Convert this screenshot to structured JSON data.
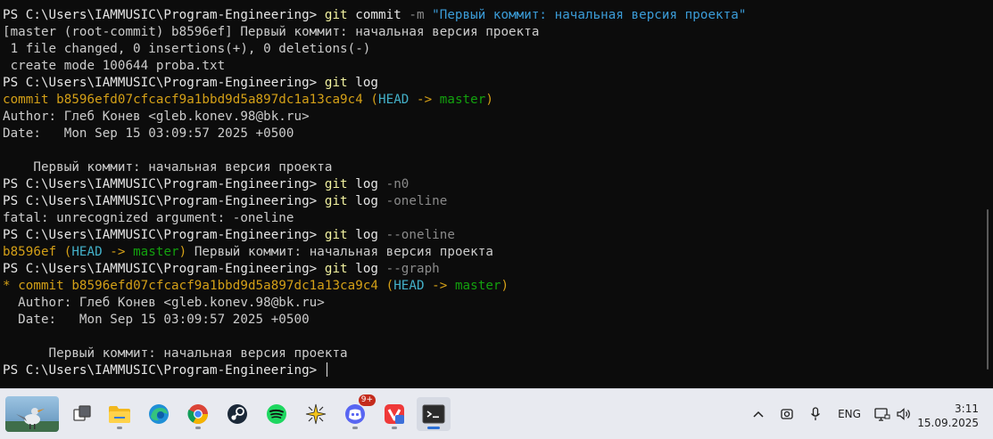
{
  "terminal": {
    "prompt": "PS C:\\Users\\IAMMUSIC\\Program-Engineering> ",
    "line01": {
      "cmd": "git",
      "args": " commit ",
      "flag": "-m",
      "msg": " \"Первый коммит: начальная версия проекта\""
    },
    "line02": "[master (root-commit) b8596ef] Первый коммит: начальная версия проекта",
    "line03": " 1 file changed, 0 insertions(+), 0 deletions(-)",
    "line04": " create mode 100644 proba.txt",
    "line05": {
      "cmd": "git",
      "args": " log"
    },
    "line06": {
      "commit_label": "commit ",
      "hash": "b8596efd07cfcacf9a1bbd9d5a897dc1a13ca9c4",
      "open": " (",
      "head": "HEAD",
      "arrow": " -> ",
      "branch": "master",
      "close": ")"
    },
    "line07": "Author: Глеб Конев <gleb.konev.98@bk.ru>",
    "line08": "Date:   Mon Sep 15 03:09:57 2025 +0500",
    "line09": "",
    "line10": "    Первый коммит: начальная версия проекта",
    "line11": {
      "cmd": "git",
      "args": " log ",
      "flag": "-n0"
    },
    "line12": {
      "cmd": "git",
      "args": " log ",
      "flag": "-oneline"
    },
    "line13": "fatal: unrecognized argument: -oneline",
    "line14": {
      "cmd": "git",
      "args": " log ",
      "flag": "--oneline"
    },
    "line15": {
      "hash": "b8596ef",
      "open": " (",
      "head": "HEAD",
      "arrow": " -> ",
      "branch": "master",
      "close": ")",
      "msg": " Первый коммит: начальная версия проекта"
    },
    "line16": {
      "cmd": "git",
      "args": " log ",
      "flag": "--graph"
    },
    "line17": {
      "star": "* ",
      "commit_label": "commit ",
      "hash": "b8596efd07cfcacf9a1bbd9d5a897dc1a13ca9c4",
      "open": " (",
      "head": "HEAD",
      "arrow": " -> ",
      "branch": "master",
      "close": ")"
    },
    "line18": "  Author: Глеб Конев <gleb.konev.98@bk.ru>",
    "line19": "  Date:   Mon Sep 15 03:09:57 2025 +0500",
    "line20": "",
    "line21": "      Первый коммит: начальная версия проекта"
  },
  "taskbar": {
    "apps": [
      "widgets",
      "task-view",
      "file-explorer",
      "edge",
      "chrome",
      "steam",
      "spotify",
      "sparkle-app",
      "discord",
      "vivaldi",
      "terminal"
    ],
    "discord_badge": "9+",
    "language": "ENG",
    "time": "3:11",
    "date": "15.09.2025"
  },
  "colors": {
    "terminal_bg": "#0c0c0c",
    "hash_yellow": "#d4a017",
    "head_cyan": "#43b0c8",
    "branch_green": "#13a10e",
    "string_blue": "#3b9cd8",
    "taskbar_bg": "#e8eaf0"
  }
}
